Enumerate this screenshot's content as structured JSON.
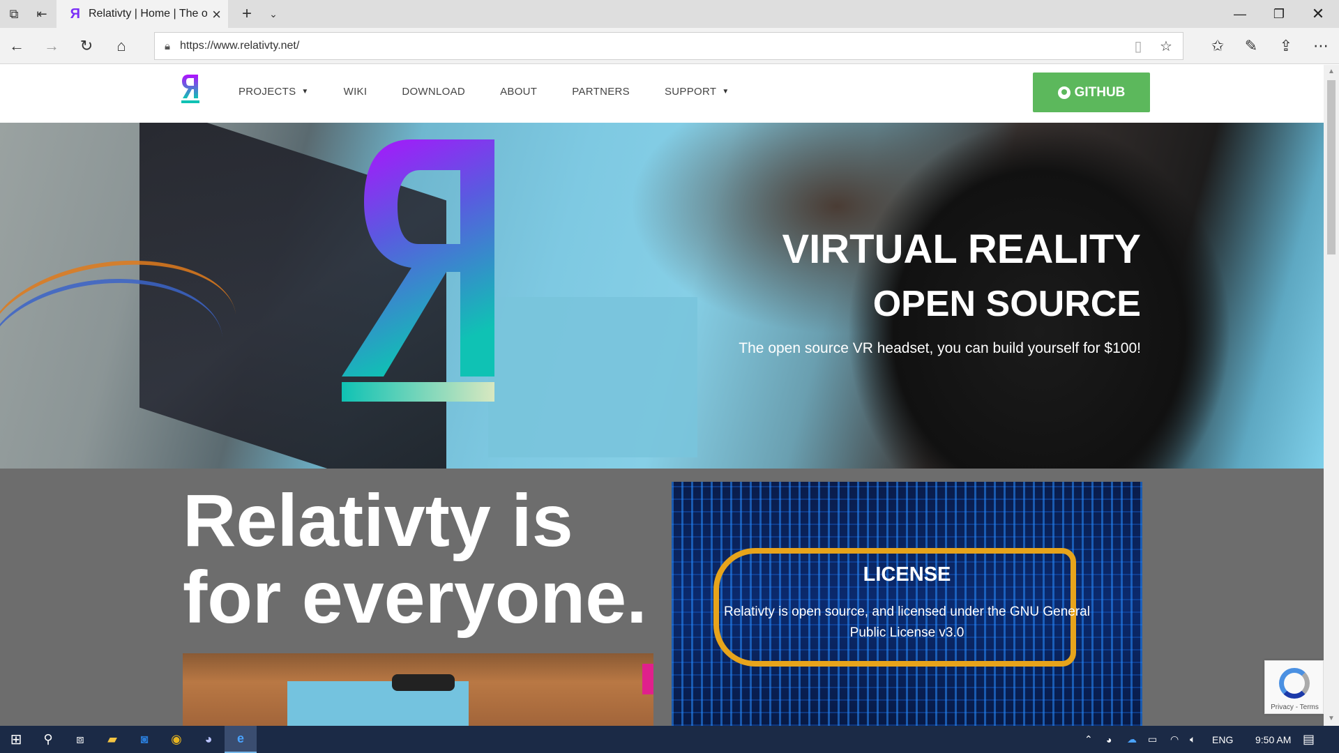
{
  "browser": {
    "tab_title": "Relativty | Home | The o",
    "url": "https://www.relativty.net/"
  },
  "site": {
    "menu": [
      {
        "label": "PROJECTS",
        "dropdown": true
      },
      {
        "label": "WIKI",
        "dropdown": false
      },
      {
        "label": "DOWNLOAD",
        "dropdown": false
      },
      {
        "label": "ABOUT",
        "dropdown": false
      },
      {
        "label": "PARTNERS",
        "dropdown": false
      },
      {
        "label": "SUPPORT",
        "dropdown": true
      }
    ],
    "github_label": "GITHUB",
    "colors": {
      "github_green": "#5cb85c",
      "grey_section": "#6d6d6d",
      "logo_top": "#b10fff",
      "logo_bottom": "#0fc2b4"
    }
  },
  "hero": {
    "title1": "VIRTUAL REALITY",
    "title2": "OPEN SOURCE",
    "subtitle": "The open source VR headset, you can build yourself for $100!"
  },
  "section": {
    "headline_line1": "Relativty is",
    "headline_line2": "for everyone.",
    "license_title": "LICENSE",
    "license_text": "Relativty is open source, and licensed under the GNU General Public License v3.0"
  },
  "recaptcha": {
    "text": "Privacy - Terms"
  },
  "taskbar": {
    "language": "ENG",
    "time": "9:50 AM"
  }
}
